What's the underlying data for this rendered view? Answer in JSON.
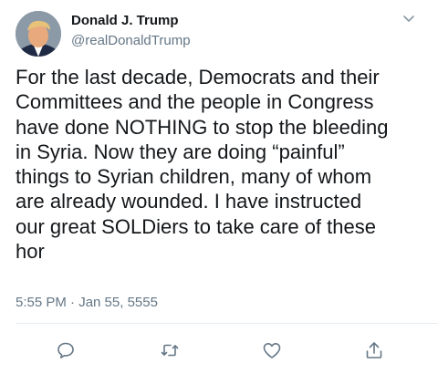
{
  "user": {
    "display_name": "Donald J. Trump",
    "handle": "@realDonaldTrump"
  },
  "tweet": {
    "text": "For the last decade, Democrats and their\nCommittees and the people in Congress\nhave done NOTHING to stop the bleeding\nin Syria. Now they are doing “painful”\nthings to Syrian children, many of whom\nare already wounded. I have instructed\nour great SOLDiers to take care of these\nhor",
    "timestamp": "5:55 PM · Jan 55, 5555"
  },
  "icons": {
    "menu": "chevron-down-icon",
    "reply": "reply-icon",
    "retweet": "retweet-icon",
    "like": "heart-icon",
    "share": "share-icon"
  },
  "colors": {
    "text": "#14171a",
    "secondary": "#657786",
    "icon": "#657786",
    "divider": "#e6ecf0"
  }
}
